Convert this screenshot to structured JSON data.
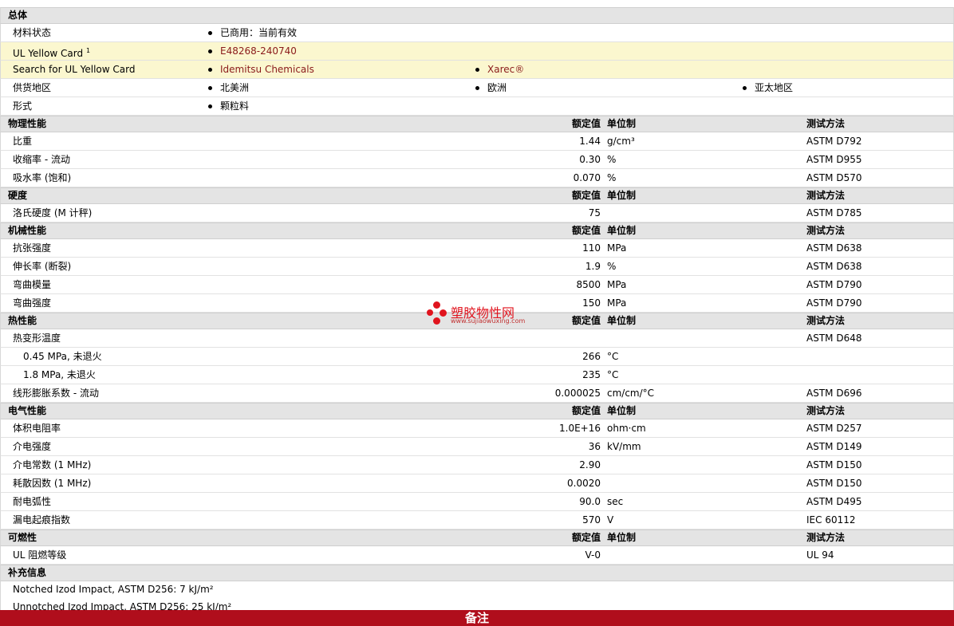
{
  "general": {
    "title": "总体",
    "material_status_label": "材料状态",
    "material_status_value": "已商用：当前有效",
    "ul_card_label": "UL Yellow Card",
    "ul_card_sup": "1",
    "ul_card_value": "E48268-240740",
    "search_label": "Search for UL Yellow Card",
    "search_link1": "Idemitsu Chemicals",
    "search_link2": "Xarec®",
    "supply_label": "供货地区",
    "supply_regions": [
      "北美洲",
      "欧洲",
      "亚太地区"
    ],
    "form_label": "形式",
    "form_value": "颗粒料"
  },
  "headers": {
    "value": "额定值",
    "unit": "单位制",
    "method": "测试方法"
  },
  "physical": {
    "title": "物理性能",
    "rows": [
      {
        "name": "比重",
        "value": "1.44",
        "unit": "g/cm³",
        "method": "ASTM D792"
      },
      {
        "name": "收缩率 - 流动",
        "value": "0.30",
        "unit": "%",
        "method": "ASTM D955"
      },
      {
        "name": "吸水率 (饱和)",
        "value": "0.070",
        "unit": "%",
        "method": "ASTM D570"
      }
    ]
  },
  "hardness": {
    "title": "硬度",
    "rows": [
      {
        "name": "洛氏硬度 (M 计秤)",
        "value": "75",
        "unit": "",
        "method": "ASTM D785"
      }
    ]
  },
  "mechanical": {
    "title": "机械性能",
    "rows": [
      {
        "name": "抗张强度",
        "value": "110",
        "unit": "MPa",
        "method": "ASTM D638"
      },
      {
        "name": "伸长率 (断裂)",
        "value": "1.9",
        "unit": "%",
        "method": "ASTM D638"
      },
      {
        "name": "弯曲模量",
        "value": "8500",
        "unit": "MPa",
        "method": "ASTM D790"
      },
      {
        "name": "弯曲强度",
        "value": "150",
        "unit": "MPa",
        "method": "ASTM D790"
      }
    ]
  },
  "thermal": {
    "title": "热性能",
    "rows": [
      {
        "name": "热变形温度",
        "value": "",
        "unit": "",
        "method": "ASTM D648"
      },
      {
        "name": "0.45 MPa, 未退火",
        "value": "266",
        "unit": "°C",
        "method": ""
      },
      {
        "name": "1.8 MPa, 未退火",
        "value": "235",
        "unit": "°C",
        "method": ""
      },
      {
        "name": "线形膨胀系数 - 流动",
        "value": "0.000025",
        "unit": "cm/cm/°C",
        "method": "ASTM D696"
      }
    ]
  },
  "electrical": {
    "title": "电气性能",
    "rows": [
      {
        "name": "体积电阻率",
        "value": "1.0E+16",
        "unit": "ohm·cm",
        "method": "ASTM D257"
      },
      {
        "name": "介电强度",
        "value": "36",
        "unit": "kV/mm",
        "method": "ASTM D149"
      },
      {
        "name": "介电常数 (1 MHz)",
        "value": "2.90",
        "unit": "",
        "method": "ASTM D150"
      },
      {
        "name": "耗散因数 (1 MHz)",
        "value": "0.0020",
        "unit": "",
        "method": "ASTM D150"
      },
      {
        "name": "耐电弧性",
        "value": "90.0",
        "unit": "sec",
        "method": "ASTM D495"
      },
      {
        "name": "漏电起痕指数",
        "value": "570",
        "unit": "V",
        "method": "IEC 60112"
      }
    ]
  },
  "flammability": {
    "title": "可燃性",
    "rows": [
      {
        "name": "UL 阻燃等级",
        "value": "V-0",
        "unit": "",
        "method": "UL 94"
      }
    ]
  },
  "supplement": {
    "title": "补充信息",
    "lines": [
      "Notched Izod Impact, ASTM D256: 7 kJ/m²",
      "Unnotched Izod Impact, ASTM D256: 25 kJ/m²"
    ]
  },
  "footer": {
    "title": "备注"
  },
  "watermark": {
    "name": "塑胶物性网",
    "url": "www.sujiaowuxing.com"
  }
}
